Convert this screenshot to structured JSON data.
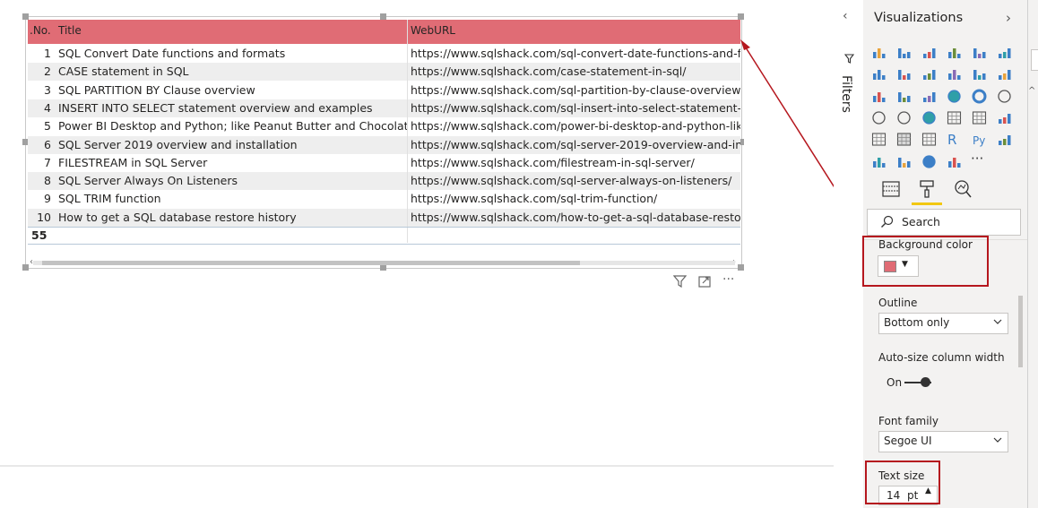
{
  "table": {
    "columns": [
      ".No.",
      "Title",
      "WebURL"
    ],
    "header_color": "#e06c75",
    "rows": [
      {
        "no": "1",
        "title": "SQL Convert Date functions and formats",
        "url": "https://www.sqlshack.com/sql-convert-date-functions-and-f"
      },
      {
        "no": "2",
        "title": "CASE statement in SQL",
        "url": "https://www.sqlshack.com/case-statement-in-sql/"
      },
      {
        "no": "3",
        "title": "SQL PARTITION BY Clause overview",
        "url": "https://www.sqlshack.com/sql-partition-by-clause-overview/"
      },
      {
        "no": "4",
        "title": "INSERT INTO SELECT statement overview and examples",
        "url": "https://www.sqlshack.com/sql-insert-into-select-statement-o"
      },
      {
        "no": "5",
        "title": "Power BI Desktop and Python; like Peanut Butter and Chocolate",
        "url": "https://www.sqlshack.com/power-bi-desktop-and-python-lik"
      },
      {
        "no": "6",
        "title": "SQL Server 2019 overview and installation",
        "url": "https://www.sqlshack.com/sql-server-2019-overview-and-ins"
      },
      {
        "no": "7",
        "title": "FILESTREAM in SQL Server",
        "url": "https://www.sqlshack.com/filestream-in-sql-server/"
      },
      {
        "no": "8",
        "title": "SQL Server Always On Listeners",
        "url": "https://www.sqlshack.com/sql-server-always-on-listeners/"
      },
      {
        "no": "9",
        "title": "SQL TRIM function",
        "url": "https://www.sqlshack.com/sql-trim-function/"
      },
      {
        "no": "10",
        "title": "How to get a SQL database restore history",
        "url": "https://www.sqlshack.com/how-to-get-a-sql-database-resto"
      }
    ],
    "total": "55"
  },
  "visual_header": {
    "filter_icon": "filter-icon",
    "focus_icon": "focus-mode-icon",
    "more_icon": "more-options-icon",
    "more_label": "···"
  },
  "filters_pane": {
    "label": "Filters"
  },
  "viz_pane": {
    "title": "Visualizations",
    "more_label": "···",
    "search_placeholder": "Search",
    "background_color": {
      "label": "Background color",
      "value": "#e06c75"
    },
    "outline": {
      "label": "Outline",
      "value": "Bottom only"
    },
    "auto_size": {
      "label": "Auto-size column width",
      "state": "On"
    },
    "font_family": {
      "label": "Font family",
      "value": "Segoe UI"
    },
    "text_size": {
      "label": "Text size",
      "value": "14",
      "unit": "pt"
    }
  },
  "accent_colors": {
    "annotation_red": "#b5171e",
    "underline_yellow": "#f2c811"
  }
}
